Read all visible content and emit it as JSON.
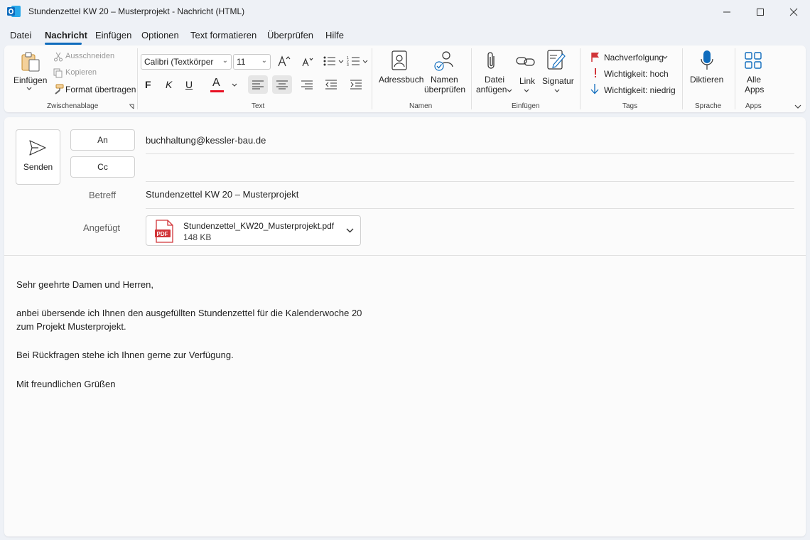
{
  "window": {
    "title": "Stundenzettel KW 20 – Musterprojekt  -  Nachricht (HTML)",
    "app_icon": "outlook-icon",
    "controls": [
      "minimize-icon",
      "maximize-icon",
      "close-icon"
    ]
  },
  "menu": {
    "tabs": [
      "Datei",
      "Nachricht",
      "Einfügen",
      "Optionen",
      "Text formatieren",
      "Überprüfen",
      "Hilfe"
    ],
    "active": "Nachricht"
  },
  "ribbon": {
    "clipboard": {
      "paste": "Einfügen",
      "cut": "Ausschneiden",
      "copy": "Kopieren",
      "format_painter": "Format übertragen",
      "group": "Zwischenablage"
    },
    "text": {
      "font": "Calibri (Textkörper",
      "size": "11",
      "bold": "F",
      "italic": "K",
      "underline": "U",
      "font_color": "A",
      "font_color_value": "#e81123",
      "group": "Text"
    },
    "names": {
      "address_book": "Adressbuch",
      "check_names_1": "Namen",
      "check_names_2": "überprüfen",
      "group": "Namen"
    },
    "insert": {
      "attach_1": "Datei",
      "attach_2": "anfügen",
      "link": "Link",
      "signature": "Signatur",
      "group": "Einfügen"
    },
    "tags": {
      "follow_up": "Nachverfolgung",
      "high": "Wichtigkeit: hoch",
      "low": "Wichtigkeit: niedrig",
      "group": "Tags"
    },
    "voice": {
      "dictate": "Diktieren",
      "group": "Sprache"
    },
    "apps": {
      "all_1": "Alle",
      "all_2": "Apps",
      "group": "Apps"
    }
  },
  "compose": {
    "send": "Senden",
    "to_button": "An",
    "cc_button": "Cc",
    "to_value": "buchhaltung@kessler-bau.de",
    "cc_value": "",
    "subject_label": "Betreff",
    "subject_value": "Stundenzettel KW 20 – Musterprojekt",
    "attached_label": "Angefügt",
    "attachment": {
      "name": "Stundenzettel_KW20_Musterprojekt.pdf",
      "size": "148 KB",
      "badge": "PDF"
    },
    "body": [
      "Sehr geehrte Damen und Herren,",
      "anbei übersende ich Ihnen den ausgefüllten Stundenzettel für die Kalenderwoche 20",
      "zum Projekt Musterprojekt.",
      "Bei Rückfragen stehe ich Ihnen gerne zur Verfügung.",
      "Mit freundlichen Grüßen"
    ]
  },
  "colors": {
    "accent": "#0f6cbd",
    "flag": "#d13438",
    "pdf": "#d13438"
  }
}
